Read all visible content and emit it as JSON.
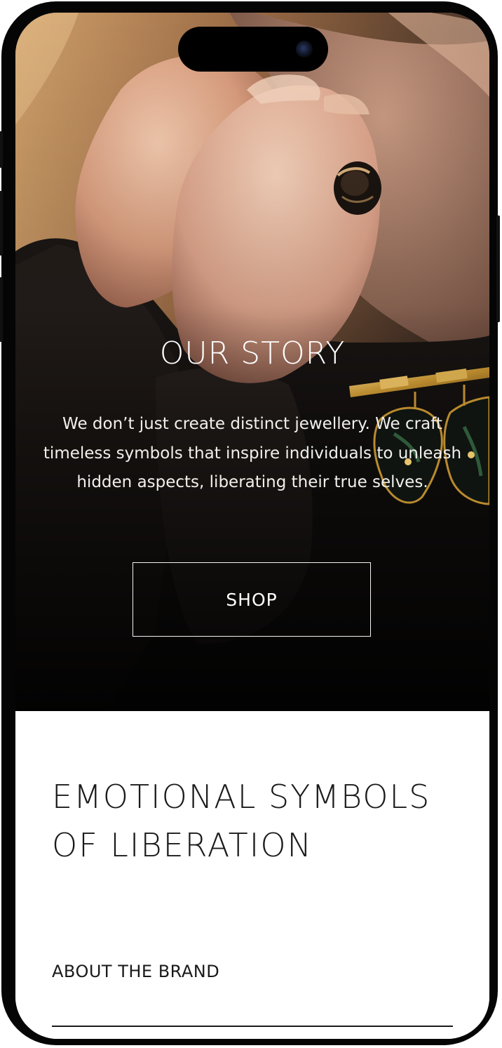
{
  "hero": {
    "title": "OUR STORY",
    "body": "We don’t just create distinct jewellery. We craft timeless symbols that inspire individuals to unleash hidden aspects, liberating their true selves.",
    "shop_label": "SHOP"
  },
  "section": {
    "headline": "EMOTIONAL SYMBOLS OF LIBERATION",
    "about_label": "ABOUT THE BRAND"
  },
  "colors": {
    "phone_frame": "#050505",
    "hero_text": "#ffffff",
    "content_background": "#ffffff",
    "content_text": "#1a1a1a"
  },
  "icons": {
    "camera": "front-camera-icon",
    "island": "dynamic-island"
  }
}
